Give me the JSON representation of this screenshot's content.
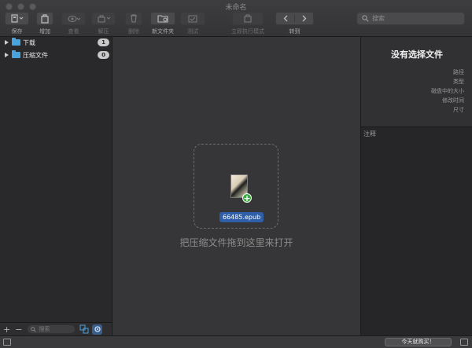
{
  "window": {
    "title": "未命名"
  },
  "toolbar": {
    "save": "保存",
    "add": "增加",
    "view": "查看",
    "extract": "解压",
    "delete": "删除",
    "new_folder": "新文件夹",
    "test": "测试",
    "run_now": "立即执行模式",
    "goto": "转到"
  },
  "search": {
    "placeholder": "搜索"
  },
  "sidebar": {
    "items": [
      {
        "label": "下载",
        "count": "1"
      },
      {
        "label": "压缩文件",
        "count": "0"
      }
    ],
    "search_placeholder": "搜索"
  },
  "center": {
    "file_name": "66485.epub",
    "hint": "把压缩文件拖到这里来打开"
  },
  "info": {
    "title": "没有选择文件",
    "fields": [
      "路径",
      "类型",
      "磁盘中的大小",
      "修改时间",
      "尺寸"
    ],
    "notes_label": "注释"
  },
  "statusbar": {
    "buy": "今天就购买！"
  },
  "colors": {
    "accent": "#2e5fa8",
    "folder": "#4aa3dc",
    "add_badge": "#3dab42"
  }
}
